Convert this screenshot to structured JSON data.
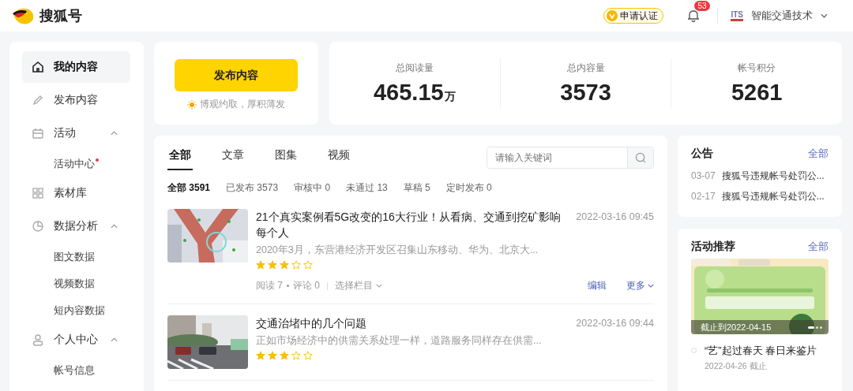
{
  "header": {
    "logo_text": "搜狐号",
    "verify_button": "申请认证",
    "notification_count": "53",
    "account_badge": "ITS",
    "account_name": "智能交通技术"
  },
  "sidebar": {
    "items": [
      {
        "label": "我的内容",
        "selected": true
      },
      {
        "label": "发布内容",
        "selected": false
      },
      {
        "label": "活动",
        "selected": false,
        "expanded": true,
        "children": [
          {
            "label": "活动中心",
            "selected": false,
            "dot": true
          }
        ]
      },
      {
        "label": "素材库",
        "selected": false
      },
      {
        "label": "数据分析",
        "selected": false,
        "expanded": true,
        "children": [
          {
            "label": "图文数据",
            "selected": false,
            "dot": false
          },
          {
            "label": "视频数据",
            "selected": false,
            "dot": false
          },
          {
            "label": "短内容数据",
            "selected": false,
            "dot": false
          }
        ]
      },
      {
        "label": "个人中心",
        "selected": false,
        "expanded": true,
        "children": [
          {
            "label": "帐号信息",
            "selected": false,
            "dot": false
          }
        ]
      }
    ]
  },
  "publish": {
    "button": "发布内容",
    "slogan": "博观约取，厚积薄发"
  },
  "stats": [
    {
      "label": "总阅读量",
      "value": "465.15",
      "unit": "万"
    },
    {
      "label": "总内容量",
      "value": "3573"
    },
    {
      "label": "帐号积分",
      "value": "5261"
    }
  ],
  "content": {
    "tabs": [
      {
        "label": "全部",
        "selected": true
      },
      {
        "label": "文章",
        "selected": false
      },
      {
        "label": "图集",
        "selected": false
      },
      {
        "label": "视频",
        "selected": false
      }
    ],
    "search": {
      "placeholder": "请输入关键词"
    },
    "filters": [
      {
        "label": "全部 3591",
        "selected": true
      },
      {
        "label": "已发布 3573",
        "selected": false
      },
      {
        "label": "审核中 0",
        "selected": false
      },
      {
        "label": "未通过 13",
        "selected": false
      },
      {
        "label": "草稿 5",
        "selected": false
      },
      {
        "label": "定时发布 0",
        "selected": false
      }
    ],
    "articles": [
      {
        "kind": "aerial",
        "title": "21个真实案例看5G改变的16大行业！从看病、交通到挖矿影响每个人",
        "date": "2022-03-16 09:45",
        "summary": "2020年3月，东营港经济开发区召集山东移动、华为、北京大...",
        "stars": 3,
        "meta": {
          "reads": "阅读 7",
          "comments": "评论 0",
          "column": "选择栏目",
          "edit": "编辑",
          "more": "更多"
        }
      },
      {
        "kind": "street",
        "title": "交通治堵中的几个问题",
        "date": "2022-03-16 09:44",
        "summary": "正如市场经济中的供需关系处理一样，道路服务同样存在供需...",
        "stars": 3
      }
    ]
  },
  "notices": {
    "title": "公告",
    "all": "全部",
    "items": [
      {
        "date": "03-07",
        "text": "搜狐号违规帐号处罚公..."
      },
      {
        "date": "02-17",
        "text": "搜狐号违规帐号处罚公..."
      }
    ]
  },
  "activities": {
    "title": "活动推荐",
    "all": "全部",
    "banner_caption": "截止到2022-04-15",
    "items": [
      {
        "title": "“艺”起过春天 春日来鉴片",
        "deadline": "2022-04-26 截止"
      }
    ]
  }
}
